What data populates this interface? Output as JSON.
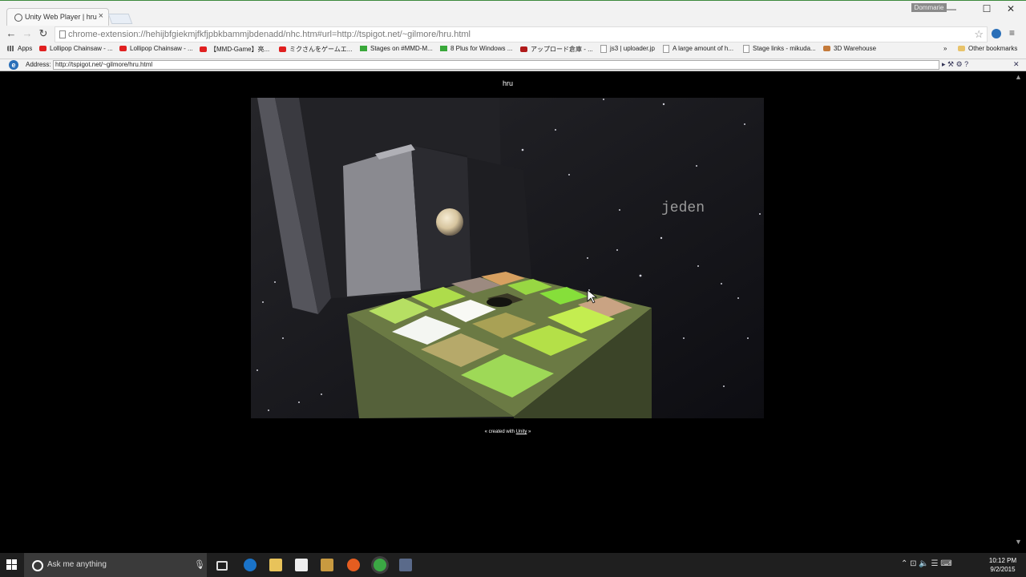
{
  "browser": {
    "tab_title": "Unity Web Player | hru",
    "tab_close": "×",
    "profile_name": "Dommarie",
    "window_controls": [
      "—",
      "☐",
      "✕"
    ],
    "nav": {
      "back": "←",
      "forward": "→",
      "reload": "↻"
    },
    "url": "chrome-extension://hehijbfgiekmjfkfjpbkbammjbdenadd/nhc.htm#url=http://tspigot.net/~gilmore/hru.html",
    "star": "☆",
    "menu": "≡",
    "bookmarks": [
      {
        "label": "Apps",
        "icon": "grid"
      },
      {
        "label": "Lollipop Chainsaw - ...",
        "icon": "yt"
      },
      {
        "label": "Lollipop Chainsaw - ...",
        "icon": "yt"
      },
      {
        "label": "【MMD-Game】亮...",
        "icon": "yt"
      },
      {
        "label": "ミクさんをゲームエ...",
        "icon": "yt"
      },
      {
        "label": "Stages on #MMD-M...",
        "icon": "green"
      },
      {
        "label": "8 Plus for Windows ...",
        "icon": "green"
      },
      {
        "label": "アップロード倉庫 - ...",
        "icon": "y"
      },
      {
        "label": "js3 | uploader.jp",
        "icon": "doc"
      },
      {
        "label": "A large amount of h...",
        "icon": "doc"
      },
      {
        "label": "Stage links - mikuda...",
        "icon": "doc"
      },
      {
        "label": "3D Warehouse",
        "icon": "thumb"
      }
    ],
    "bookmarks_overflow": "»",
    "other_bookmarks": "Other bookmarks"
  },
  "ie_tab": {
    "address_label": "Address:",
    "address_value": "http://tspigot.net/~gilmore/hru.html",
    "logo": "e",
    "tools": "▸ ⚒ ⚙ ?",
    "close": "✕"
  },
  "page": {
    "title": "hru",
    "game_overlay_text": "jeden",
    "created_prefix": "« created with ",
    "created_link": "Unity",
    "created_suffix": " »"
  },
  "scrollbar": {
    "up": "▲",
    "down": "▼"
  },
  "taskbar": {
    "search_placeholder": "Ask me anything",
    "mic": "🎙",
    "tray_icons": "⌃  ⊡  🔈  ☰  ⌨",
    "time": "10:12 PM",
    "date": "9/2/2015"
  }
}
